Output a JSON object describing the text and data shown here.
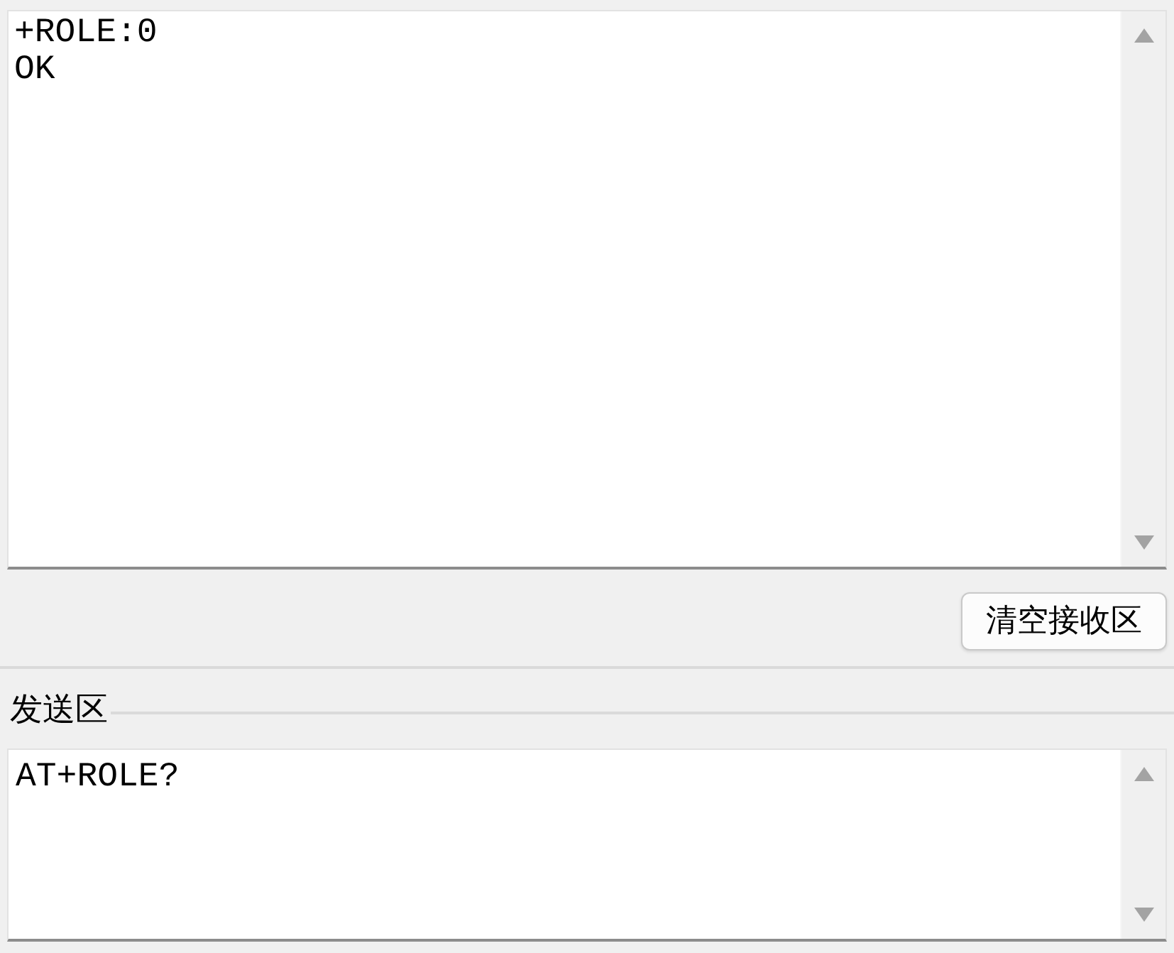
{
  "receive_area": {
    "lines": [
      "+ROLE:0",
      "OK"
    ]
  },
  "clear_button": {
    "label": "清空接收区"
  },
  "send_section": {
    "title": "发送区",
    "value": "AT+ROLE?"
  }
}
